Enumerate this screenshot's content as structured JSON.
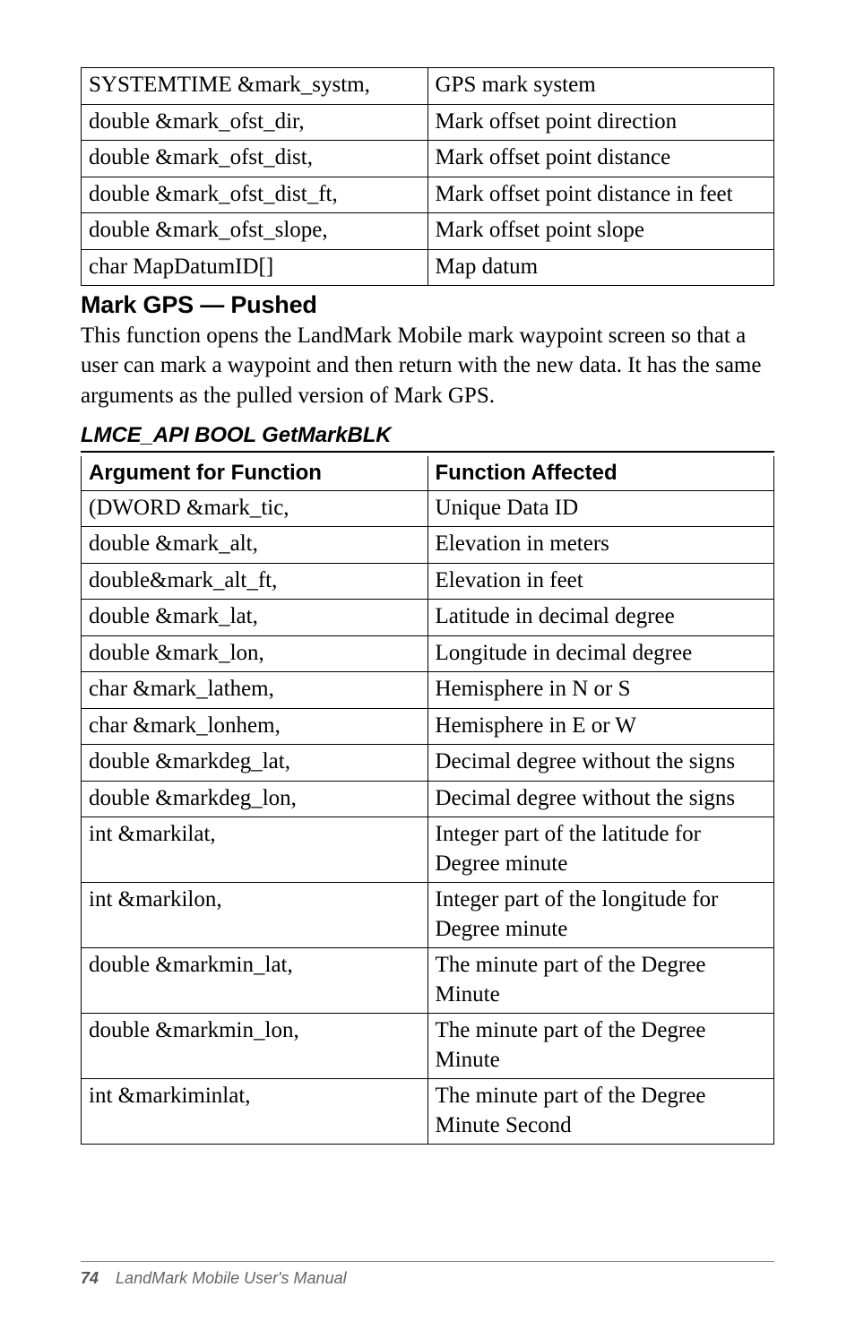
{
  "table1": {
    "rows": [
      {
        "arg": "SYSTEMTIME &mark_systm,",
        "desc": "GPS mark system"
      },
      {
        "arg": "double &mark_ofst_dir,",
        "desc": "Mark offset point direction"
      },
      {
        "arg": "double &mark_ofst_dist,",
        "desc": "Mark offset point distance"
      },
      {
        "arg": "double &mark_ofst_dist_ft,",
        "desc": "Mark offset point distance in feet"
      },
      {
        "arg": "double &mark_ofst_slope,",
        "desc": "Mark offset point slope"
      },
      {
        "arg": "char MapDatumID[]",
        "desc": "Map datum"
      }
    ]
  },
  "section": {
    "heading": "Mark GPS — Pushed",
    "paragraph": "This function opens the LandMark Mobile mark waypoint screen so that a user can mark a waypoint and then return with the new data. It has the same arguments as the pulled version of Mark GPS.",
    "subheading": "LMCE_API BOOL GetMarkBLK"
  },
  "table2": {
    "header": {
      "left": "Argument for Function",
      "right": "Function Affected"
    },
    "rows": [
      {
        "arg": "(DWORD &mark_tic,",
        "desc": "Unique Data ID"
      },
      {
        "arg": "double &mark_alt,",
        "desc": "Elevation in meters"
      },
      {
        "arg": "double&mark_alt_ft,",
        "desc": "Elevation in feet"
      },
      {
        "arg": "double &mark_lat,",
        "desc": "Latitude in decimal degree"
      },
      {
        "arg": "double &mark_lon,",
        "desc": "Longitude in decimal degree"
      },
      {
        "arg": "char &mark_lathem,",
        "desc": "Hemisphere in N or S"
      },
      {
        "arg": "char &mark_lonhem,",
        "desc": "Hemisphere in E or W"
      },
      {
        "arg": "double &markdeg_lat,",
        "desc": "Decimal degree without the signs"
      },
      {
        "arg": "double &markdeg_lon,",
        "desc": "Decimal degree without the signs"
      },
      {
        "arg": "int &markilat,",
        "desc": "Integer part of the latitude for Degree minute"
      },
      {
        "arg": "int &markilon,",
        "desc": "Integer part of the longitude for Degree minute"
      },
      {
        "arg": "double &markmin_lat,",
        "desc": "The minute part of the Degree Minute"
      },
      {
        "arg": "double &markmin_lon,",
        "desc": "The minute part of the Degree Minute"
      },
      {
        "arg": "int &markiminlat,",
        "desc": "The minute part of the Degree Minute Second"
      }
    ]
  },
  "footer": {
    "page": "74",
    "title": "LandMark Mobile User's Manual"
  }
}
